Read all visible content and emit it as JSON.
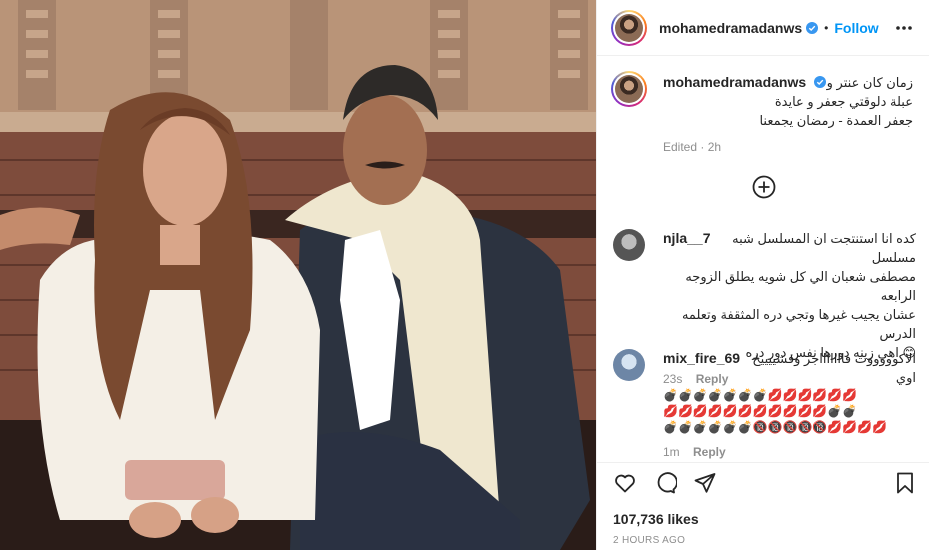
{
  "post": {
    "username": "mohamedramadanws",
    "follow_label": "Follow",
    "separator": "•",
    "caption_lines": [
      "زمان كان عنتر و",
      "عبلة دلوقتي جعفر و عايدة",
      "جعفر العمدة - رمضان يجمعنا"
    ],
    "caption_meta": "Edited · 2h",
    "likes": "107,736 likes",
    "time_ago": "2 HOURS AGO"
  },
  "comments": [
    {
      "username": "njla__7",
      "text_lines": [
        "كده انا استنتجت ان المسلسل شبه مسلسل",
        "مصطفى شعبان الي كل شويه يطلق الزوجه الرابعه",
        "عشان يجيب غيرها وتجي دره المثقفة وتعلمه الدرس",
        "😊 اهي زينه دورها نفس دور دره"
      ],
      "time": "23s",
      "reply_label": "Reply"
    },
    {
      "username": "mix_fire_69",
      "text_lines": [
        "الاكوووووت فاااااااجر وفشييييخ اوي"
      ],
      "emoji_lines": [
        "💣💣💣💣💣💣💣💋💋💋💋💋💋",
        "💋💋💋💋💋💋💋💋💋💋💋💣💣",
        "💣💣💣💣💣💣🔞🔞🔞🔞🔞💋💋💋💋"
      ],
      "time": "1m",
      "reply_label": "Reply"
    }
  ],
  "icons": {
    "like": "heart-icon",
    "comment": "comment-icon",
    "share": "paper-plane-icon",
    "save": "bookmark-icon",
    "more": "more-options-icon",
    "load_more": "plus-circle-icon",
    "verified": "verified-badge-icon"
  },
  "colors": {
    "accent": "#0095f6",
    "verified": "#3897f0",
    "muted": "#8e8e8e",
    "text": "#262626"
  }
}
